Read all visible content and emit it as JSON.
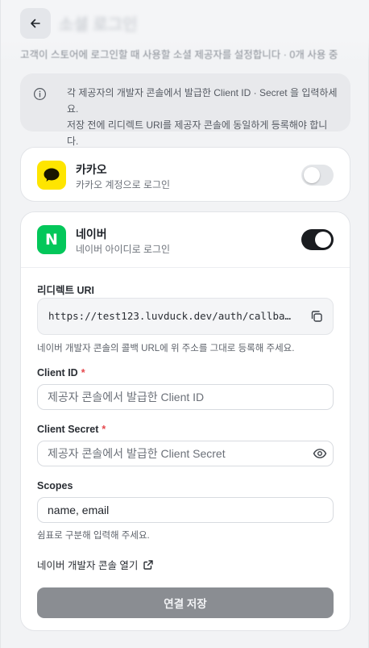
{
  "header": {
    "back_icon": "arrow-left-icon",
    "title": "소셜 로그인",
    "subtitle": "고객이 스토어에 로그인할 때 사용할 소셜 제공자를 설정합니다 · 0개 사용 중"
  },
  "info": {
    "icon": "info-icon",
    "line1": "각 제공자의 개발자 콘솔에서 발급한 Client ID · Secret 을 입력하세요.",
    "line2": "저장 전에 리디렉트 URI를 제공자 콘솔에 동일하게 등록해야 합니다."
  },
  "providers": {
    "kakao": {
      "name": "카카오",
      "description": "카카오 계정으로 로그인",
      "enabled": false,
      "brand_color": "#FEE500"
    },
    "naver": {
      "name": "네이버",
      "logo_letter": "N",
      "description": "네이버 아이디로 로그인",
      "enabled": true,
      "brand_color": "#03C75A",
      "redirect_label": "리디렉트 URI",
      "redirect_uri": "https://test123.luvduck.dev/auth/callback…",
      "redirect_help": "네이버 개발자 콘솔의 콜백 URL에 위 주소를 그대로 등록해 주세요.",
      "client_id_label": "Client ID",
      "client_id_placeholder": "제공자 콘솔에서 발급한 Client ID",
      "client_id_value": "",
      "client_secret_label": "Client Secret",
      "client_secret_placeholder": "제공자 콘솔에서 발급한 Client Secret",
      "client_secret_value": "",
      "required_mark": "*",
      "scopes_label": "Scopes",
      "scopes_value": "name, email",
      "scopes_help": "쉼표로 구분해 입력해 주세요.",
      "console_link": "네이버 개발자 콘솔 열기",
      "save_label": "연결 저장"
    }
  },
  "colors": {
    "toggle_on": "#1A1C20",
    "toggle_off": "#E4E6E9",
    "required": "#E5484D",
    "save_disabled": "#8A8D92"
  }
}
